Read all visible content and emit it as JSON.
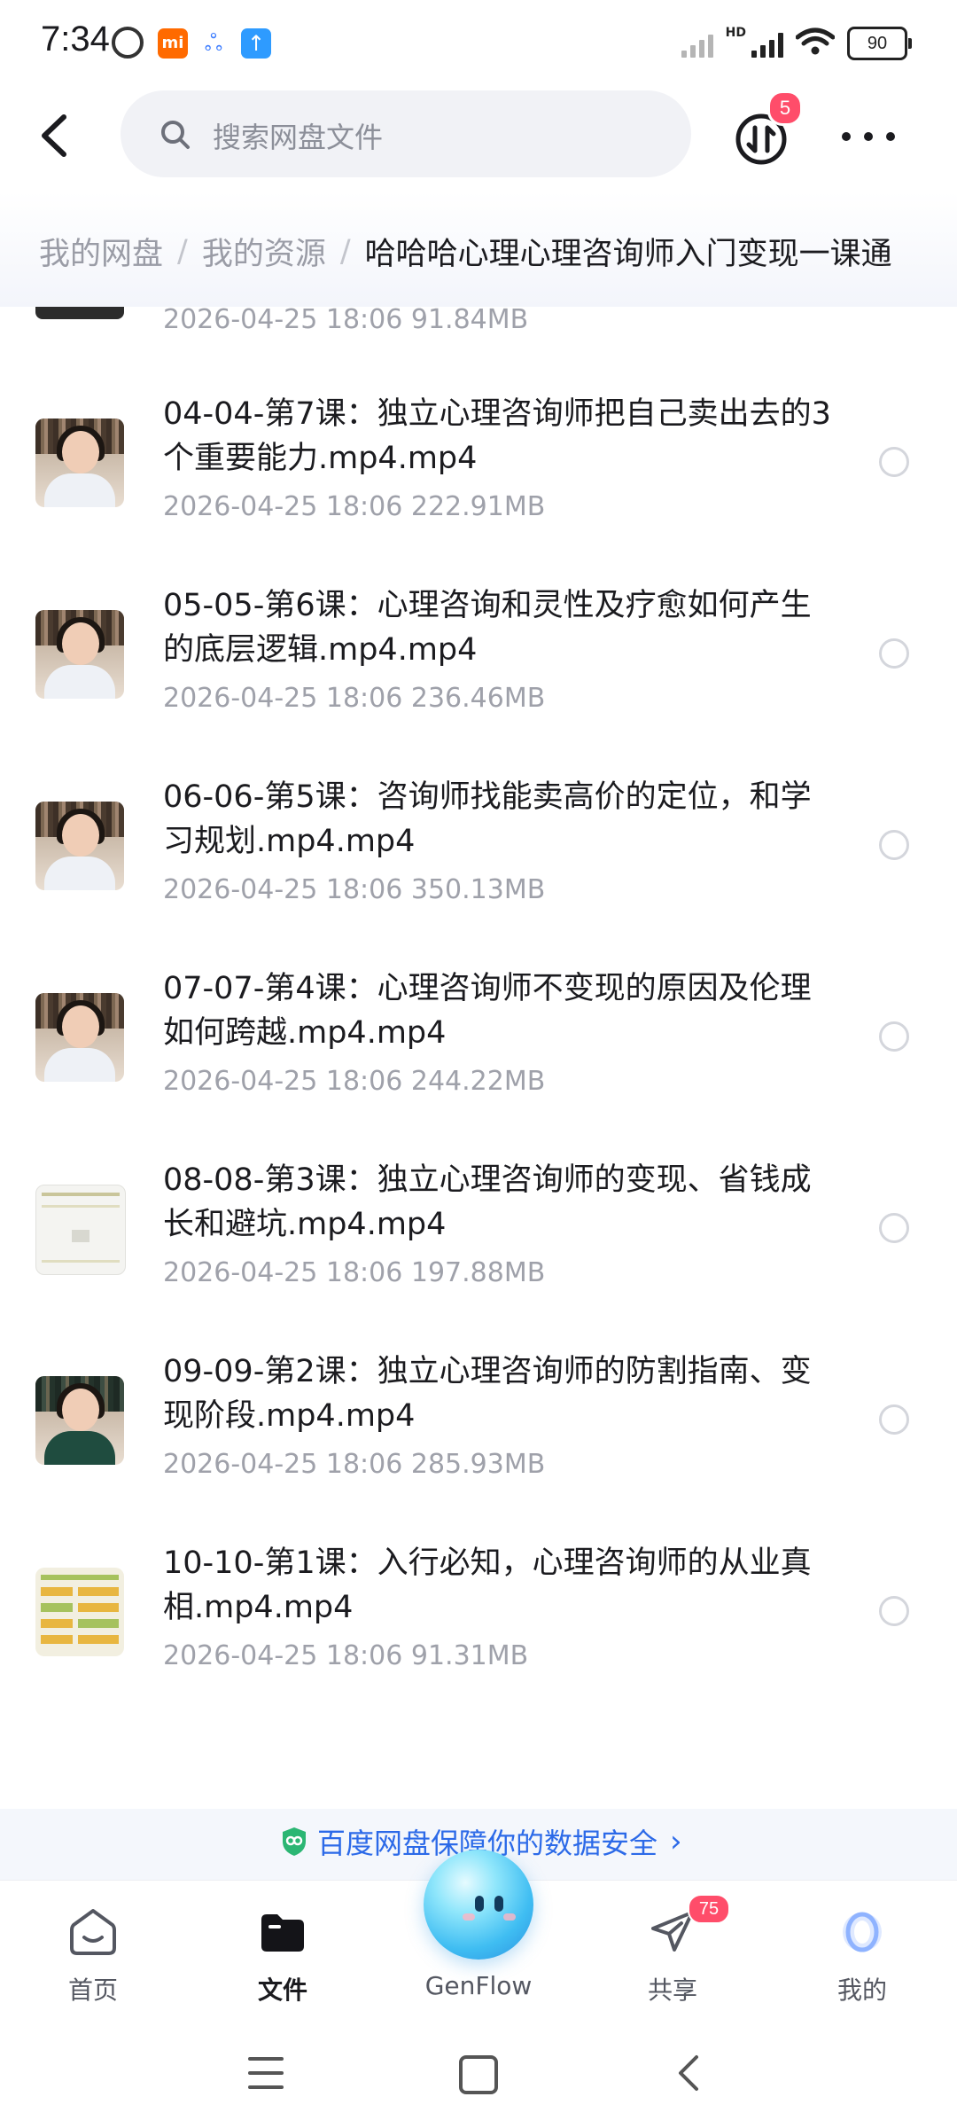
{
  "status_bar": {
    "time": "7:34",
    "battery": "90",
    "network_label": "HD",
    "icons": [
      "alarm-icon",
      "mi-app-icon",
      "baidu-netdisk-icon",
      "upload-icon",
      "signal-icon",
      "wifi-icon",
      "battery-icon"
    ]
  },
  "top_bar": {
    "search_placeholder": "搜索网盘文件",
    "transfer_badge": "5"
  },
  "breadcrumb": {
    "items": [
      "我的网盘",
      "我的资源"
    ],
    "separator": "/",
    "current": "哈哈哈心理心理咨询师入门变现一课通"
  },
  "partial_row": {
    "meta": "2026-04-25  18:06  91.84MB"
  },
  "files": [
    {
      "name": "04-04-第7课：独立心理咨询师把自己卖出去的3个重要能力.mp4.mp4",
      "meta": "2026-04-25  18:06  222.91MB",
      "thumb": "video"
    },
    {
      "name": "05-05-第6课：心理咨询和灵性及疗愈如何产生的底层逻辑.mp4.mp4",
      "meta": "2026-04-25  18:06  236.46MB",
      "thumb": "video"
    },
    {
      "name": "06-06-第5课：咨询师找能卖高价的定位，和学习规划.mp4.mp4",
      "meta": "2026-04-25  18:06  350.13MB",
      "thumb": "video"
    },
    {
      "name": "07-07-第4课：心理咨询师不变现的原因及伦理如何跨越.mp4.mp4",
      "meta": "2026-04-25  18:06  244.22MB",
      "thumb": "video"
    },
    {
      "name": "08-08-第3课：独立心理咨询师的变现、省钱成长和避坑.mp4.mp4",
      "meta": "2026-04-25  18:06  197.88MB",
      "thumb": "slide"
    },
    {
      "name": "09-09-第2课：独立心理咨询师的防割指南、变现阶段.mp4.mp4",
      "meta": "2026-04-25  18:06  285.93MB",
      "thumb": "video"
    },
    {
      "name": "10-10-第1课：入行必知，心理咨询师的从业真相.mp4.mp4",
      "meta": "2026-04-25  18:06  91.31MB",
      "thumb": "slide2"
    }
  ],
  "security_note": "百度网盘保障你的数据安全",
  "tab_bar": {
    "tabs": [
      {
        "label": "首页",
        "icon": "home-icon"
      },
      {
        "label": "文件",
        "icon": "folder-icon"
      },
      {
        "label": "GenFlow",
        "icon": "genflow-orb-icon"
      },
      {
        "label": "共享",
        "icon": "share-plane-icon"
      },
      {
        "label": "我的",
        "icon": "profile-ring-icon"
      }
    ],
    "share_badge": "75"
  },
  "colors": {
    "accent": "#2c6ae8",
    "badge": "#ff4d6a",
    "muted_text": "#9fa1aa"
  }
}
